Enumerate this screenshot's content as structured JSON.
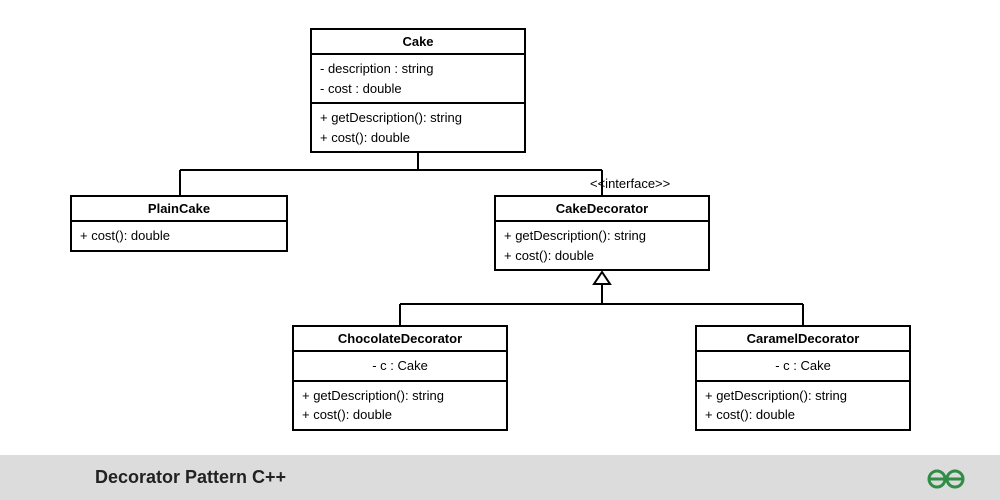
{
  "diagram": {
    "title": "Decorator Pattern C++",
    "stereotype_label": "<<interface>>",
    "classes": {
      "cake": {
        "name": "Cake",
        "attrs": [
          "-  description : string",
          "-  cost : double"
        ],
        "ops": [
          "+  getDescription(): string",
          "+  cost(): double"
        ]
      },
      "plaincake": {
        "name": "PlainCake",
        "ops": [
          "+  cost(): double"
        ]
      },
      "cakedecorator": {
        "name": "CakeDecorator",
        "ops": [
          "+  getDescription(): string",
          "+  cost(): double"
        ]
      },
      "chocolatedecorator": {
        "name": "ChocolateDecorator",
        "attrs": [
          "-  c : Cake"
        ],
        "ops": [
          "+  getDescription(): string",
          "+  cost(): double"
        ]
      },
      "carameldecorator": {
        "name": "CaramelDecorator",
        "attrs": [
          "-  c : Cake"
        ],
        "ops": [
          "+  getDescription(): string",
          "+  cost(): double"
        ]
      }
    }
  }
}
